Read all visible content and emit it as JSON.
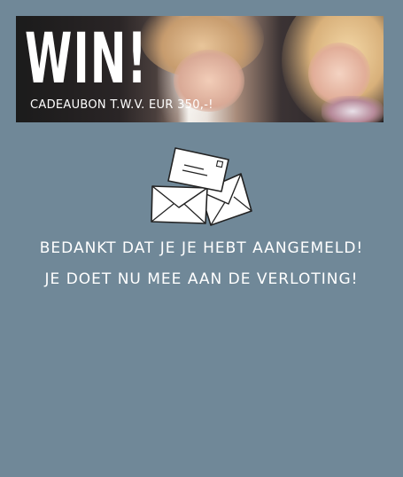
{
  "banner": {
    "headline": "WIN!",
    "subline": "CADEAUBON T.W.V. EUR 350,-!"
  },
  "envelopes_icon": "envelopes-icon",
  "confirmation": {
    "line1": "BEDANKT DAT JE JE HEBT AANGEMELD!",
    "line2": "JE DOET NU MEE AAN DE VERLOTING!"
  },
  "colors": {
    "background": "#708898",
    "text": "#ffffff"
  }
}
